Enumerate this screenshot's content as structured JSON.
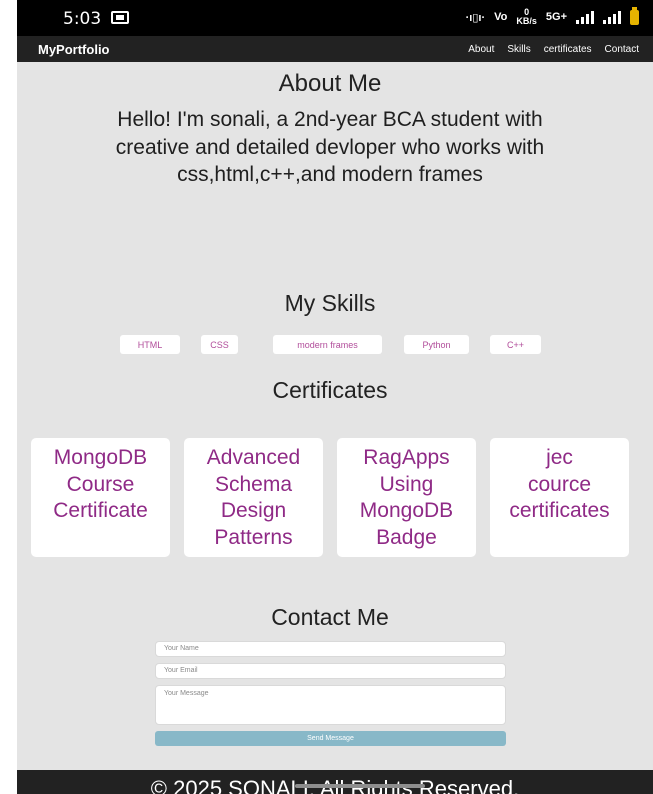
{
  "status_bar": {
    "time": "5:03",
    "net_speed_value": "0",
    "net_speed_unit": "KB/s",
    "network_type": "5G+"
  },
  "navbar": {
    "brand": "MyPortfolio",
    "links": [
      "About",
      "Skills",
      "certificates",
      "Contact"
    ]
  },
  "about": {
    "title": "About Me",
    "text": "Hello! I'm sonali, a 2nd-year BCA student with creative and detailed devloper who works with css,html,c++,and modern frames"
  },
  "skills": {
    "title": "My Skills",
    "items": [
      "HTML",
      "CSS",
      "modern frames",
      "Python",
      "C++"
    ]
  },
  "certificates": {
    "title": "Certificates",
    "items": [
      "MongoDB Course Certificate",
      "Advanced Schema Design Patterns",
      "RagApps Using MongoDB Badge",
      "jec cource certificates"
    ]
  },
  "contact": {
    "title": "Contact Me",
    "name_placeholder": "Your Name",
    "email_placeholder": "Your Email",
    "message_placeholder": "Your Message",
    "send_label": "Send Message"
  },
  "footer": {
    "text": "© 2025 SONALI. All Rights Reserved."
  },
  "colors": {
    "page_bg": "#e4e4e4",
    "navbar_bg": "#222222",
    "accent_text": "#8f2a86",
    "button": "#88b8c8"
  }
}
